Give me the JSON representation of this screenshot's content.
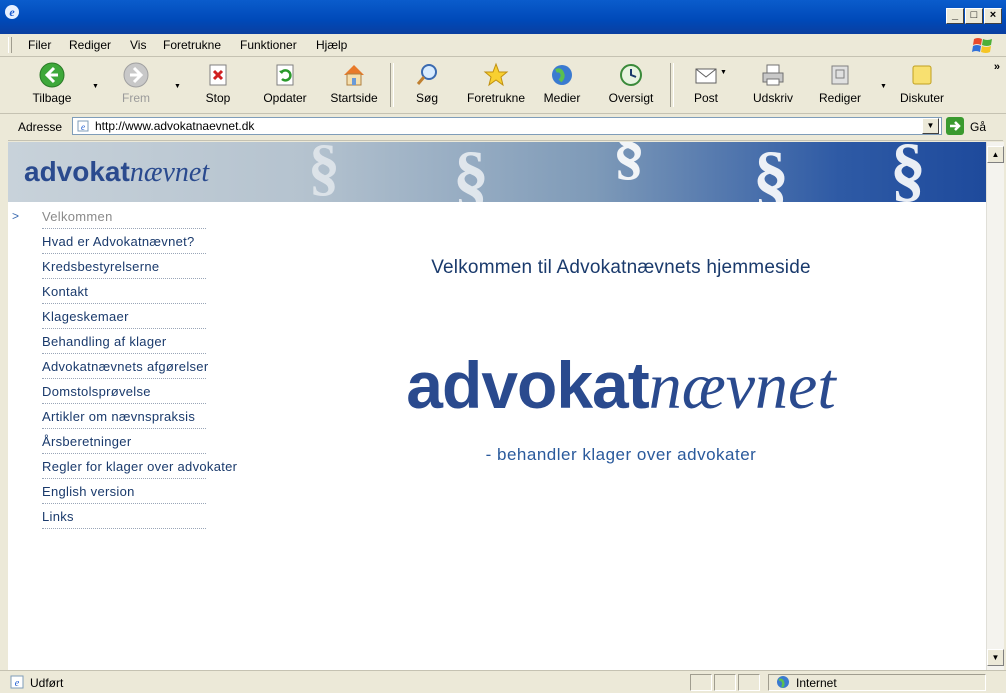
{
  "window": {
    "min_label": "_",
    "max_label": "□",
    "close_label": "×"
  },
  "menu": {
    "items": [
      "Filer",
      "Rediger",
      "Vis",
      "Foretrukne",
      "Funktioner",
      "Hjælp"
    ]
  },
  "toolbar": {
    "back": "Tilbage",
    "forward": "Frem",
    "stop": "Stop",
    "refresh": "Opdater",
    "home": "Startside",
    "search": "Søg",
    "favorites": "Foretrukne",
    "media": "Medier",
    "history": "Oversigt",
    "mail": "Post",
    "print": "Udskriv",
    "edit": "Rediger",
    "discuss": "Diskuter",
    "more": "»"
  },
  "address": {
    "label": "Adresse",
    "url": "http://www.advokatnaevnet.dk",
    "go": "Gå"
  },
  "banner": {
    "logo_bold": "advokat",
    "logo_italic": "nævnet"
  },
  "nav": {
    "items": [
      "Velkommen",
      "Hvad er Advokatnævnet?",
      "Kredsbestyrelserne",
      "Kontakt",
      "Klageskemaer",
      "Behandling af klager",
      "Advokatnævnets afgørelser",
      "Domstolsprøvelse",
      "Artikler om nævnspraksis",
      "Årsberetninger",
      "Regler for klager over advokater",
      "English version",
      "Links"
    ],
    "active_bullet": ">"
  },
  "main": {
    "welcome": "Velkommen til Advokatnævnets hjemmeside",
    "logo_bold": "advokat",
    "logo_italic": "nævnet",
    "tagline": "- behandler klager over advokater"
  },
  "status": {
    "text": "Udført",
    "zone": "Internet"
  },
  "colors": {
    "brand_blue": "#2a4a8e",
    "nav_text": "#1a3a6c",
    "title_blue": "#0a5ccc"
  }
}
